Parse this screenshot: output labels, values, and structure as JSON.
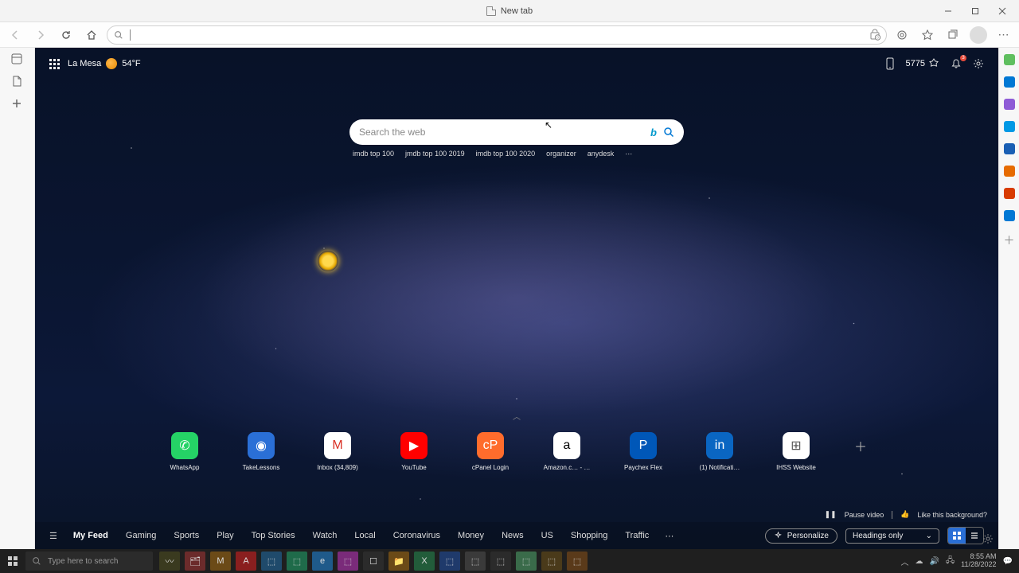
{
  "window": {
    "tab_title": "New tab"
  },
  "weather": {
    "location": "La Mesa",
    "temp": "54°F"
  },
  "rewards": {
    "points": "5775"
  },
  "notifications": {
    "count": "3"
  },
  "search": {
    "placeholder": "Search the web"
  },
  "suggestions": [
    "imdb top 100",
    "jmdb top 100 2019",
    "imdb top 100 2020",
    "organizer",
    "anydesk"
  ],
  "quick_links": [
    {
      "label": "WhatsApp",
      "glyph": "✆",
      "bg": "#25d366",
      "fg": "#fff"
    },
    {
      "label": "TakeLessons",
      "glyph": "◉",
      "bg": "#2a6fd6",
      "fg": "#fff"
    },
    {
      "label": "Inbox (34,809)",
      "glyph": "M",
      "bg": "#fff",
      "fg": "#d93025"
    },
    {
      "label": "YouTube",
      "glyph": "▶",
      "bg": "#ff0000",
      "fg": "#fff"
    },
    {
      "label": "cPanel Login",
      "glyph": "cP",
      "bg": "#ff6c2c",
      "fg": "#fff"
    },
    {
      "label": "Amazon.c… - …",
      "glyph": "a",
      "bg": "#fff",
      "fg": "#000"
    },
    {
      "label": "Paychex Flex",
      "glyph": "P",
      "bg": "#0057b8",
      "fg": "#fff"
    },
    {
      "label": "(1) Notificati…",
      "glyph": "in",
      "bg": "#0a66c2",
      "fg": "#fff"
    },
    {
      "label": "IHSS Website",
      "glyph": "⊞",
      "bg": "#fff",
      "fg": "#555"
    }
  ],
  "bg_controls": {
    "pause": "Pause video",
    "like": "Like this background?"
  },
  "feed": {
    "tabs": [
      "My Feed",
      "Gaming",
      "Sports",
      "Play",
      "Top Stories",
      "Watch",
      "Local",
      "Coronavirus",
      "Money",
      "News",
      "US",
      "Shopping",
      "Traffic"
    ],
    "active": 0,
    "personalize": "Personalize",
    "headings": "Headings only"
  },
  "taskbar": {
    "search_placeholder": "Type here to search",
    "time": "8:55 AM",
    "date": "11/28/2022"
  },
  "sidepanel_colors": [
    "#5fbf5f",
    "#0078d4",
    "#8e5bd6",
    "#0099e5",
    "#1a5fb4",
    "#e66b00",
    "#d83b01",
    "#0078d4"
  ]
}
